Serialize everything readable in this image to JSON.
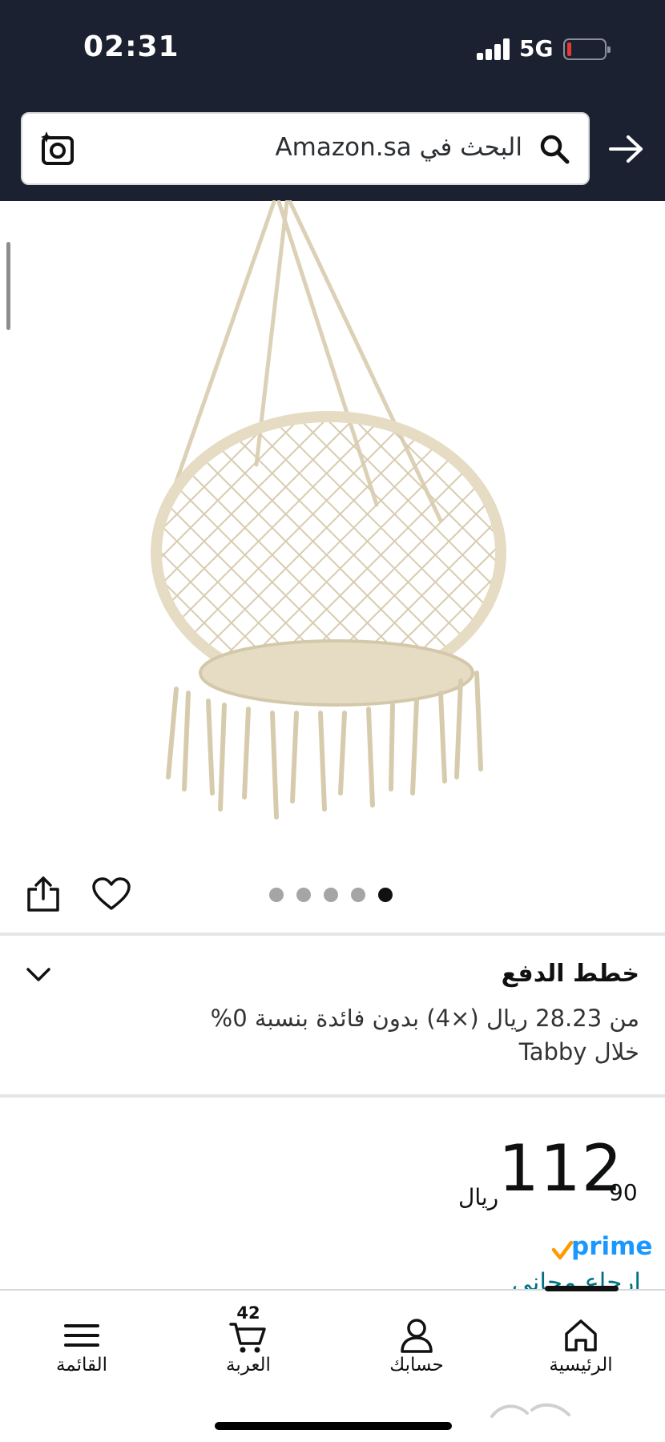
{
  "status_bar": {
    "time": "02:31",
    "network": "5G",
    "battery_level": 0.08
  },
  "search": {
    "placeholder": "البحث في Amazon.sa"
  },
  "gallery": {
    "dots_total": 5,
    "active_dot": 5
  },
  "payment_plans": {
    "title": "خطط الدفع",
    "line1": "من 28.23 ريال (×4) بدون فائدة بنسبة 0%",
    "line2": "خلال Tabby"
  },
  "price": {
    "whole": "112",
    "fraction": "90",
    "currency": "ريال"
  },
  "prime": {
    "label": "prime"
  },
  "delivery": {
    "free_return": "ارجاع مجاني"
  },
  "bottom_nav": {
    "home": "الرئيسية",
    "account": "حسابك",
    "cart": "العربة",
    "cart_count": "42",
    "menu": "القائمة"
  },
  "colors": {
    "header_bg": "#1b2130",
    "link": "#007185",
    "prime_blue": "#1a98ff",
    "prime_check": "#ff9900"
  }
}
